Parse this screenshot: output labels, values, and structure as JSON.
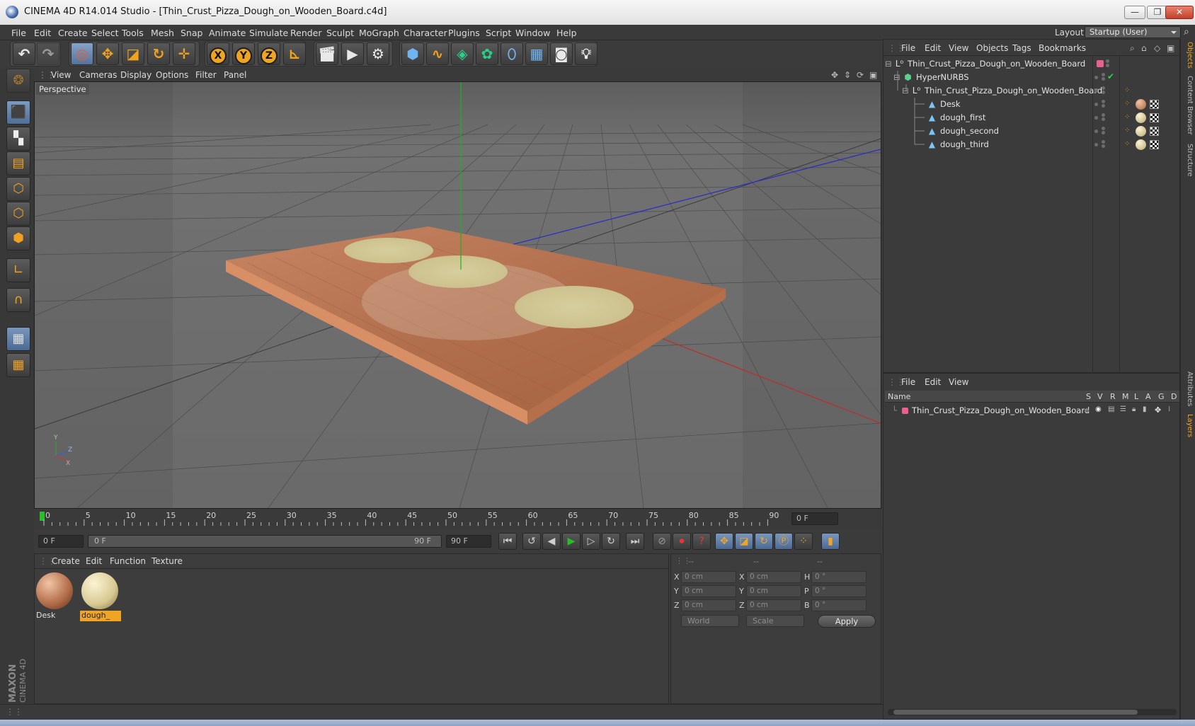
{
  "window": {
    "title": "CINEMA 4D R14.014 Studio - [Thin_Crust_Pizza_Dough_on_Wooden_Board.c4d]",
    "minimize": "—",
    "restore": "❐",
    "close": "✕"
  },
  "menubar": {
    "items": [
      "File",
      "Edit",
      "Create",
      "Select",
      "Tools",
      "Mesh",
      "Snap",
      "Animate",
      "Simulate",
      "Render",
      "Sculpt",
      "MoGraph",
      "Character",
      "Plugins",
      "Script",
      "Window",
      "Help"
    ],
    "layout_label": "Layout:",
    "layout_value": "Startup (User)"
  },
  "viewport": {
    "menu": [
      "View",
      "Cameras",
      "Display",
      "Options",
      "Filter",
      "Panel"
    ],
    "label": "Perspective",
    "axis_labels": {
      "y": "Y",
      "z": "Z",
      "x": "X"
    }
  },
  "timeline": {
    "ticks": [
      "0",
      "5",
      "10",
      "15",
      "20",
      "25",
      "30",
      "35",
      "40",
      "45",
      "50",
      "55",
      "60",
      "65",
      "70",
      "75",
      "80",
      "85",
      "90"
    ],
    "current_frame_field": "0 F",
    "start_field": "0 F",
    "range_start": "0 F",
    "range_end": "90 F",
    "end_field": "90 F"
  },
  "material_manager": {
    "menu": [
      "Create",
      "Edit",
      "Function",
      "Texture"
    ],
    "materials": [
      {
        "name": "Desk",
        "selected": false
      },
      {
        "name": "dough_",
        "selected": true
      }
    ]
  },
  "coordinates": {
    "col_headers": [
      "--",
      "--",
      "--"
    ],
    "rows": [
      {
        "l1": "X",
        "v1": "0 cm",
        "l2": "X",
        "v2": "0 cm",
        "l3": "H",
        "v3": "0 °"
      },
      {
        "l1": "Y",
        "v1": "0 cm",
        "l2": "Y",
        "v2": "0 cm",
        "l3": "P",
        "v3": "0 °"
      },
      {
        "l1": "Z",
        "v1": "0 cm",
        "l2": "Z",
        "v2": "0 cm",
        "l3": "B",
        "v3": "0 °"
      }
    ],
    "space": "World",
    "mode": "Scale",
    "apply": "Apply"
  },
  "object_manager": {
    "menu": [
      "File",
      "Edit",
      "View",
      "Objects",
      "Tags",
      "Bookmarks"
    ],
    "objects": [
      {
        "name": "Thin_Crust_Pizza_Dough_on_Wooden_Board",
        "icon": "null-icon",
        "depth": 0
      },
      {
        "name": "HyperNURBS",
        "icon": "hypernurbs-icon",
        "depth": 1
      },
      {
        "name": "Thin_Crust_Pizza_Dough_on_Wooden_Board",
        "icon": "null-icon",
        "depth": 2
      },
      {
        "name": "Desk",
        "icon": "polygon-object-icon",
        "depth": 3
      },
      {
        "name": "dough_first",
        "icon": "polygon-object-icon",
        "depth": 3
      },
      {
        "name": "dough_second",
        "icon": "polygon-object-icon",
        "depth": 3
      },
      {
        "name": "dough_third",
        "icon": "polygon-object-icon",
        "depth": 3
      }
    ]
  },
  "layer_manager": {
    "menu": [
      "File",
      "Edit",
      "View"
    ],
    "columns": [
      "Name",
      "S",
      "V",
      "R",
      "M",
      "L",
      "A",
      "G",
      "D"
    ],
    "layers": [
      {
        "name": "Thin_Crust_Pizza_Dough_on_Wooden_Board",
        "color": "#e8628c"
      }
    ]
  },
  "right_tabs": [
    "Objects",
    "Content Browser",
    "Structure",
    "Attributes",
    "Layers"
  ],
  "brand": {
    "line1": "MAXON",
    "line2": "CINEMA 4D"
  },
  "colors": {
    "accent": "#f0a522",
    "selection_blue": "#6f8fb8",
    "board": "#b06e4a",
    "dough": "#d8cfa0"
  }
}
